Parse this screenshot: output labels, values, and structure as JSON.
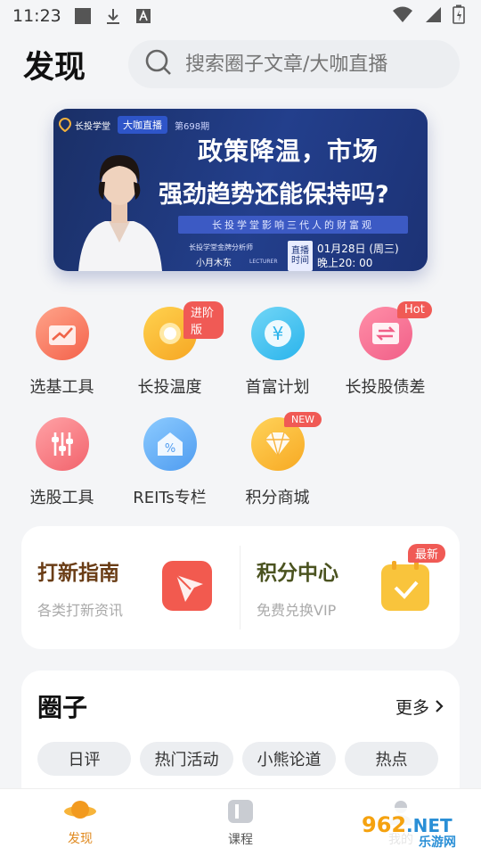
{
  "status": {
    "time": "11:23"
  },
  "header": {
    "title": "发现",
    "search_placeholder": "搜索圈子文章/大咖直播"
  },
  "banner": {
    "brand": "长投学堂",
    "live": "大咖直播",
    "episode": "第698期",
    "headline1": "政策降温，市场",
    "headline2": "强劲趋势还能保持吗?",
    "subtitle": "长投学堂影响三代人的财富观",
    "analyst": "长投学堂金牌分析师",
    "name": "小月木东",
    "lecturer": "LECTURER",
    "time_label": "直播时间",
    "date": "01月28日 (周三)",
    "time": "晚上20: 00"
  },
  "tools": [
    {
      "label": "选基工具",
      "icon": "chart-up-icon"
    },
    {
      "label": "长投温度",
      "icon": "thermometer-icon",
      "badge": "进阶版"
    },
    {
      "label": "首富计划",
      "icon": "yen-icon"
    },
    {
      "label": "长投股债差",
      "icon": "exchange-icon",
      "badge": "Hot"
    },
    {
      "label": "选股工具",
      "icon": "sliders-icon"
    },
    {
      "label": "REITs专栏",
      "icon": "percent-house-icon"
    },
    {
      "label": "积分商城",
      "icon": "diamond-icon",
      "badge": "NEW"
    }
  ],
  "highlights": [
    {
      "title": "打新指南",
      "subtitle": "各类打新资讯"
    },
    {
      "title": "积分中心",
      "subtitle": "免费兑换VIP",
      "badge": "最新"
    }
  ],
  "circle": {
    "title": "圈子",
    "more": "更多",
    "tags": [
      "日评",
      "热门活动",
      "小熊论道",
      "热点"
    ]
  },
  "tabbar": {
    "tabs": [
      {
        "label": "发现"
      },
      {
        "label": "课程"
      },
      {
        "label": "我的"
      }
    ]
  },
  "watermark": {
    "text1": "962",
    "text2": ".NET",
    "text3": "乐游网"
  },
  "colors": {
    "accent": "#e08a20",
    "badge_red": "#f05a55"
  }
}
